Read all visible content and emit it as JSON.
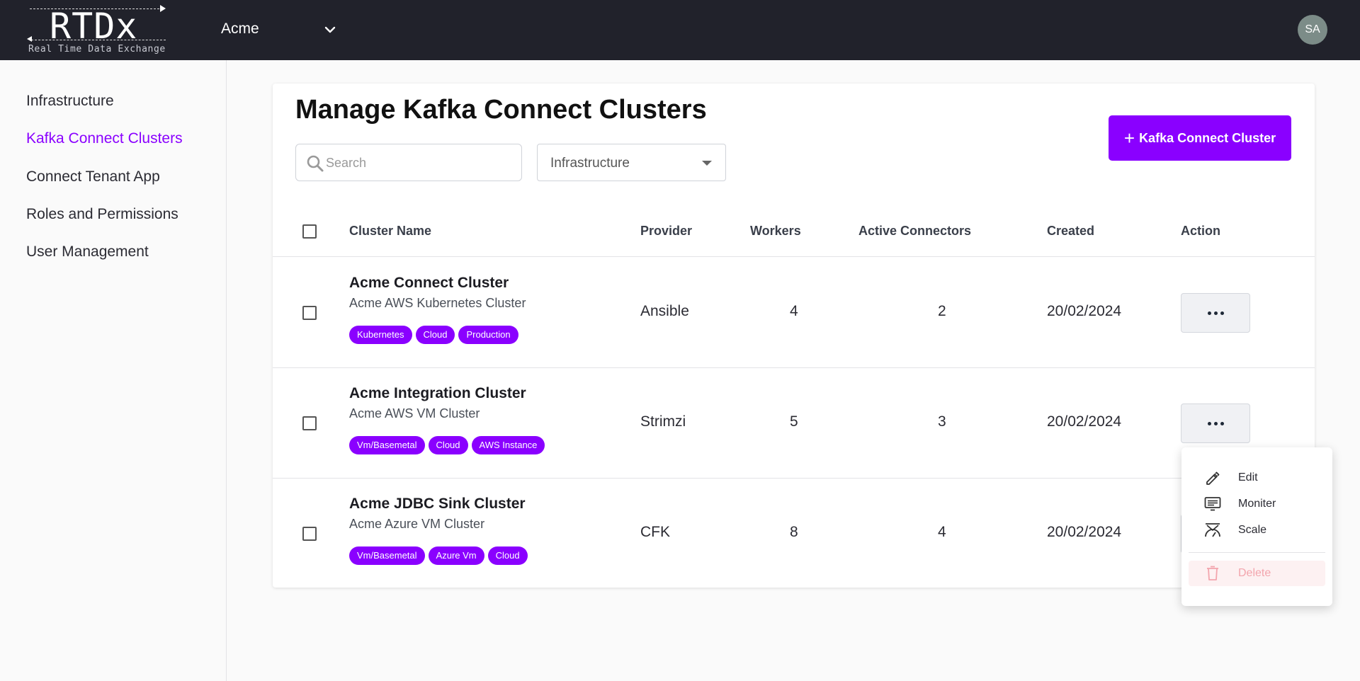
{
  "brand": {
    "logo_text": "RTDx",
    "tagline": "Real Time Data Exchange"
  },
  "header": {
    "tenant": "Acme",
    "avatar_initials": "SA"
  },
  "sidebar": {
    "items": [
      {
        "label": "Infrastructure"
      },
      {
        "label": "Kafka Connect Clusters",
        "active": true
      },
      {
        "label": "Connect Tenant App"
      },
      {
        "label": "Roles and Permissions"
      },
      {
        "label": "User Management"
      }
    ]
  },
  "page": {
    "title": "Manage Kafka Connect Clusters",
    "search_placeholder": "Search",
    "filter_value": "Infrastructure",
    "add_button_label": "Kafka Connect Cluster"
  },
  "table": {
    "columns": [
      "Cluster Name",
      "Provider",
      "Workers",
      "Active Connectors",
      "Created",
      "Action"
    ],
    "rows": [
      {
        "name": "Acme Connect Cluster",
        "description": "Acme AWS Kubernetes Cluster",
        "tags": [
          "Kubernetes",
          "Cloud",
          "Production"
        ],
        "provider": "Ansible",
        "workers": "4",
        "active_connectors": "2",
        "created": "20/02/2024"
      },
      {
        "name": "Acme Integration Cluster",
        "description": "Acme AWS VM Cluster",
        "tags": [
          "Vm/Basemetal",
          "Cloud",
          "AWS Instance"
        ],
        "provider": "Strimzi",
        "workers": "5",
        "active_connectors": "3",
        "created": "20/02/2024"
      },
      {
        "name": "Acme JDBC Sink Cluster",
        "description": "Acme Azure VM Cluster",
        "tags": [
          "Vm/Basemetal",
          "Azure Vm",
          "Cloud"
        ],
        "provider": "CFK",
        "workers": "8",
        "active_connectors": "4",
        "created": "20/02/2024"
      }
    ]
  },
  "action_menu": {
    "items": [
      {
        "label": "Edit",
        "icon": "pencil-icon"
      },
      {
        "label": "Moniter",
        "icon": "monitor-icon"
      },
      {
        "label": "Scale",
        "icon": "scale-icon"
      },
      {
        "label": "Delete",
        "icon": "trash-icon"
      }
    ]
  },
  "colors": {
    "accent": "#8a00ff",
    "topbar": "#21222b",
    "avatar": "#7c8c88",
    "delete_text": "#f3a5ad"
  }
}
